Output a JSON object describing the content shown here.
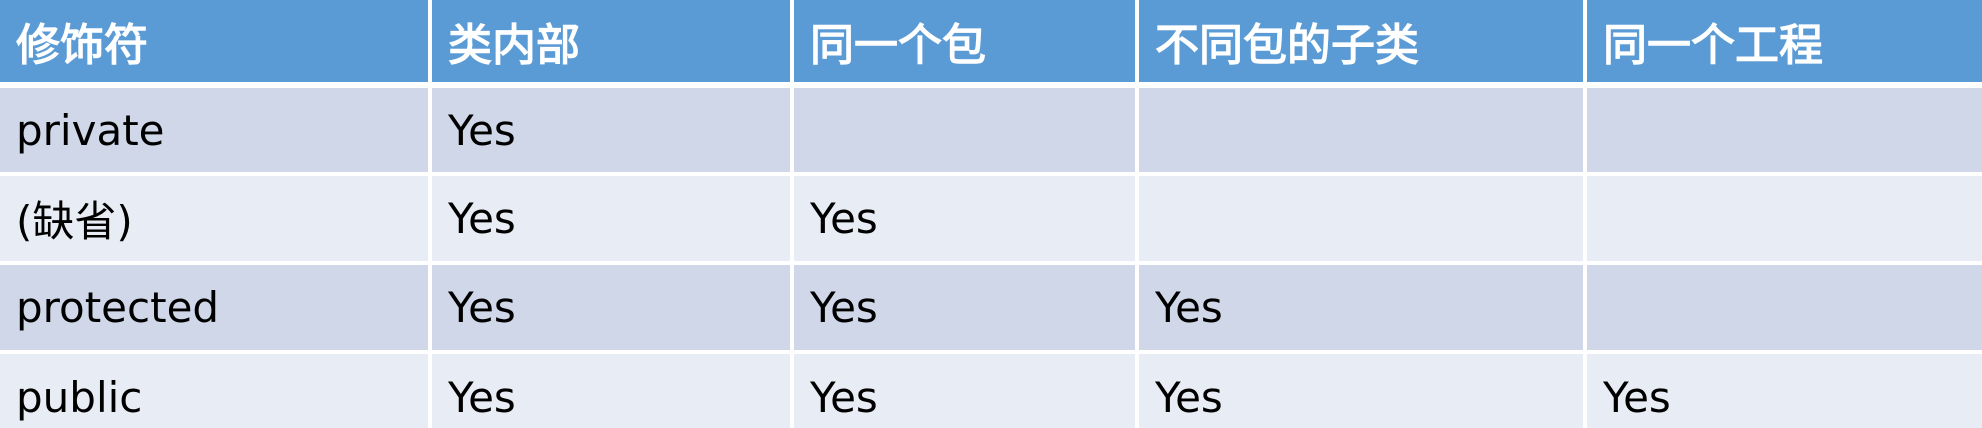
{
  "table": {
    "headers": [
      "修饰符",
      "类内部",
      "同一个包",
      "不同包的子类",
      "同一个工程"
    ],
    "rows": [
      [
        "private",
        "Yes",
        "",
        "",
        ""
      ],
      [
        "(缺省)",
        "Yes",
        "Yes",
        "",
        ""
      ],
      [
        "protected",
        "Yes",
        "Yes",
        "Yes",
        ""
      ],
      [
        "public",
        "Yes",
        "Yes",
        "Yes",
        "Yes"
      ]
    ]
  },
  "colors": {
    "header_bg": "#5b9bd5",
    "header_text": "#ffffff",
    "row_odd_bg": "#cfd7e8",
    "row_even_bg": "#e8ecf4",
    "cell_text": "#000000",
    "divider": "#ffffff"
  }
}
